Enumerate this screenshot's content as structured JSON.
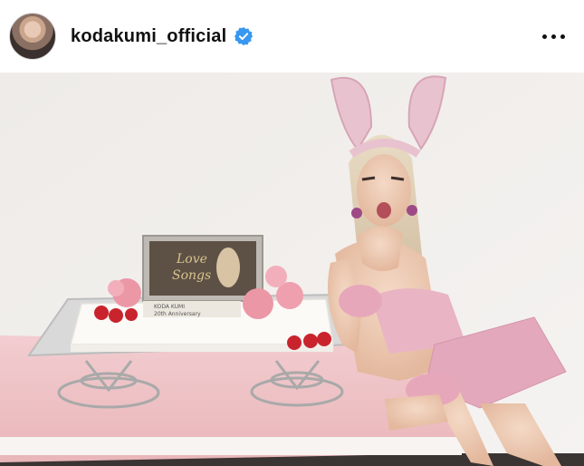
{
  "header": {
    "username": "kodakumi_official",
    "verified_icon": "verified-badge-icon",
    "more_icon": "more-horizontal-icon",
    "verified_color": "#3897f0"
  },
  "photo": {
    "plaque": {
      "script_line1": "Love",
      "script_line2": "Songs",
      "name_line": "KODA KUMI",
      "anniversary_line": "20th Anniversary"
    },
    "colors": {
      "wall": "#f2efec",
      "tablecloth": "#efc3c7",
      "outfit": "#e9b4c4",
      "cake": "#fbfaf7",
      "roses": "#ec97a6"
    }
  }
}
